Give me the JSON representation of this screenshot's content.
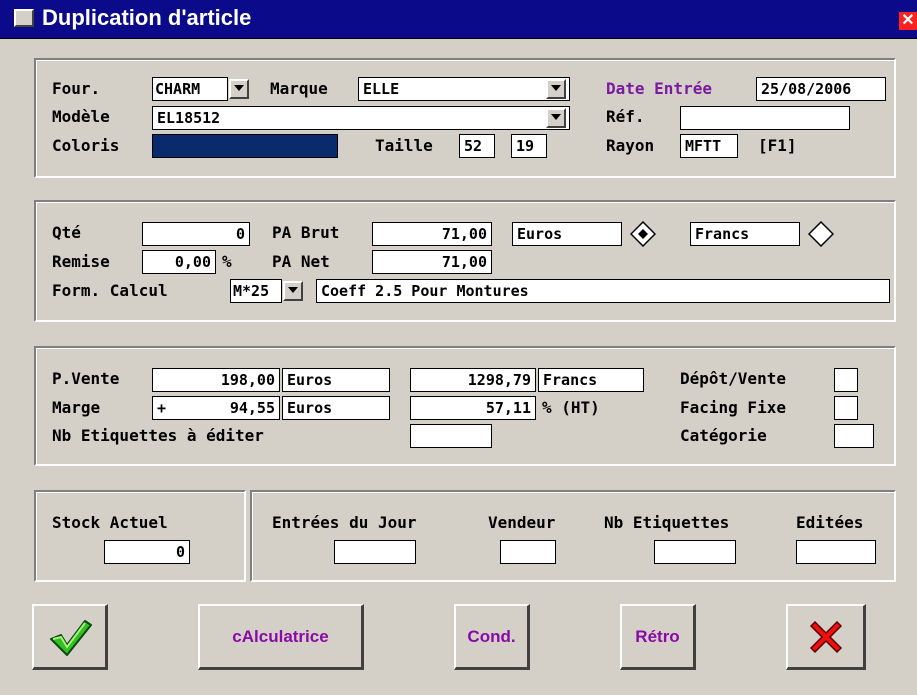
{
  "window": {
    "title": "Duplication d'article",
    "close_glyph": "✕"
  },
  "supplier": {
    "four_label": "Four.",
    "four_value": "CHARM",
    "marque_label": "Marque",
    "marque_value": "ELLE",
    "date_label": "Date Entrée",
    "date_value": "25/08/2006",
    "modele_label": "Modèle",
    "modele_value": "EL18512",
    "ref_label": "Réf.",
    "ref_value": "",
    "coloris_label": "Coloris",
    "coloris_value": "",
    "taille_label": "Taille",
    "taille_1": "52",
    "taille_2": "19",
    "rayon_label": "Rayon",
    "rayon_value": "MFTT",
    "rayon_hint": "[F1]"
  },
  "purchase": {
    "qte_label": "Qté",
    "qte_value": "0",
    "pabrut_label": "PA Brut",
    "pabrut_value": "71,00",
    "currency_euros": "Euros",
    "currency_francs": "Francs",
    "currency_selected": "Euros",
    "remise_label": "Remise",
    "remise_value": "0,00",
    "remise_unit": "%",
    "panet_label": "PA Net",
    "panet_value": "71,00",
    "form_label": "Form. Calcul",
    "form_code": "M*25",
    "form_desc": "Coeff 2.5 Pour Montures"
  },
  "sale": {
    "pvente_label": "P.Vente",
    "pvente_value": "198,00",
    "pvente_currency": "Euros",
    "pvente_francs_value": "1298,79",
    "pvente_francs_currency": "Francs",
    "marge_label": "Marge",
    "marge_sign": "+",
    "marge_value": "94,55",
    "marge_currency": "Euros",
    "marge_pct_value": "57,11",
    "marge_pct_unit": "% (HT)",
    "nbetiq_label": "Nb Etiquettes à éditer",
    "nbetiq_value": "",
    "depot_label": "Dépôt/Vente",
    "facing_label": "Facing Fixe",
    "categorie_label": "Catégorie",
    "depot_checked": false,
    "facing_checked": false,
    "categorie_value": ""
  },
  "stock": {
    "label": "Stock Actuel",
    "value": "0"
  },
  "daily": {
    "entrees_label": "Entrées du Jour",
    "vendeur_label": "Vendeur",
    "nbetiq_label": "Nb Etiquettes",
    "editees_label": "Editées",
    "entrees_value": "",
    "vendeur_value": "",
    "nbetiq_value": "",
    "editees_value": ""
  },
  "buttons": {
    "ok_icon": "checkmark-icon",
    "calc_label": "cAlculatrice",
    "cond_label": "Cond.",
    "retro_label": "Rétro",
    "cancel_icon": "red-x-icon"
  },
  "colors": {
    "title_bar": "#0a0a8a",
    "window_bg": "#d4d0c8",
    "accent_purple": "#7b1aa0",
    "coloris_fill": "#0a2a6e"
  }
}
